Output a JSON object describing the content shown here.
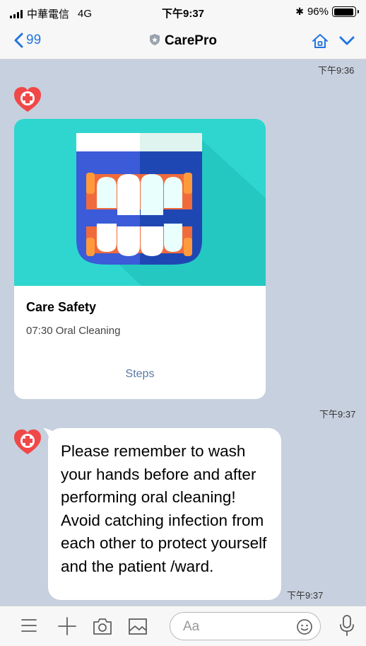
{
  "status_bar": {
    "carrier": "中華電信",
    "network": "4G",
    "time": "下午9:37",
    "bluetooth": "✱",
    "battery": "96%",
    "battery_level": 0.96
  },
  "nav": {
    "back_count": "99",
    "title": "CarePro",
    "icons": [
      "chevron-left-icon",
      "shield-icon",
      "home-icon",
      "chevron-down-icon"
    ],
    "accent": "#2474e0"
  },
  "chat": {
    "messages": [
      {
        "timestamp": "下午9:36"
      },
      {
        "type": "card",
        "title": "Care Safety",
        "subtitle": "07:30 Oral Cleaning",
        "action": "Steps",
        "timestamp": "下午9:37"
      },
      {
        "type": "text",
        "text": "Please remember to wash your hands before and after performing oral cleaning! Avoid catching infection from each other to protect yourself and the patient /ward.",
        "timestamp": "下午9:37"
      }
    ]
  },
  "input_bar": {
    "placeholder": "Aa",
    "icons": [
      "menu-icon",
      "plus-icon",
      "camera-icon",
      "image-icon",
      "emoji-icon",
      "microphone-icon"
    ]
  },
  "colors": {
    "chat_background": "#c7d0de",
    "hero_background": "#2fd6cf",
    "link": "#5a78a8"
  }
}
